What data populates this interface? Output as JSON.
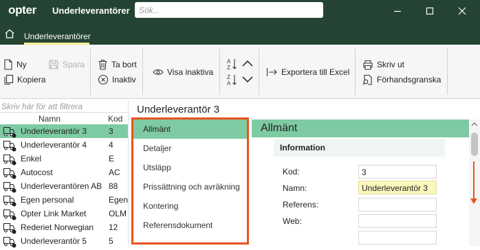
{
  "app": {
    "logo": "opter",
    "window_title": "Underleverantörer",
    "search_placeholder": "Sök...",
    "nav_tab": "Underleverantörer"
  },
  "ribbon": {
    "new": "Ny",
    "save": "Spara",
    "copy": "Kopiera",
    "delete": "Ta bort",
    "inactive": "Inaktiv",
    "show_inactive": "Visa inaktiva",
    "export_excel": "Exportera till Excel",
    "print": "Skriv ut",
    "preview": "Förhandsgranska"
  },
  "list": {
    "filter_placeholder": "Skriv här för att filtrera",
    "col_name": "Namn",
    "col_kod": "Kod",
    "rows": [
      {
        "name": "Underleverantör 3",
        "kod": "3",
        "selected": true
      },
      {
        "name": "Underleverantör 4",
        "kod": "4"
      },
      {
        "name": "Enkel",
        "kod": "E"
      },
      {
        "name": "Autocost",
        "kod": "AC"
      },
      {
        "name": "Underleverantören AB",
        "kod": "88"
      },
      {
        "name": "Egen personal",
        "kod": "Egen"
      },
      {
        "name": "Opter Link Market",
        "kod": "OLM"
      },
      {
        "name": "Rederiet Norwegian",
        "kod": "12"
      },
      {
        "name": "Underleverantör 5",
        "kod": "5"
      }
    ]
  },
  "detail": {
    "title": "Underleverantör 3",
    "sections": [
      "Allmänt",
      "Detaljer",
      "Utsläpp",
      "Prissättning och avräkning",
      "Kontering",
      "Referensdokument"
    ],
    "selected_section": "Allmänt",
    "section_header": "Allmänt",
    "info_header": "Information",
    "fields": [
      {
        "label": "Kod:",
        "value": "3"
      },
      {
        "label": "Namn:",
        "value": "Underleverantör 3"
      },
      {
        "label": "Referens:",
        "value": ""
      },
      {
        "label": "Web:",
        "value": ""
      },
      {
        "label": "",
        "value": ""
      }
    ]
  },
  "colors": {
    "header_bg": "#244333",
    "selection_green": "#7ecba3",
    "highlight_border": "#e8531c",
    "nav_underline": "#f4f08e"
  }
}
